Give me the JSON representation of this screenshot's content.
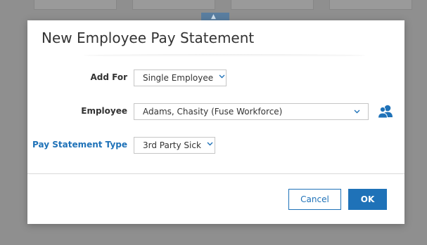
{
  "dialog": {
    "title": "New Employee Pay Statement"
  },
  "form": {
    "add_for": {
      "label": "Add For",
      "value": "Single Employee"
    },
    "employee": {
      "label": "Employee",
      "value": "Adams, Chasity (Fuse Workforce)",
      "picker_icon": "people-icon"
    },
    "pay_statement_type": {
      "label": "Pay Statement Type",
      "value": "3rd Party Sick"
    }
  },
  "buttons": {
    "cancel_label": "Cancel",
    "ok_label": "OK"
  },
  "colors": {
    "accent": "#1f72b8",
    "overlay": "#8f8f8f"
  }
}
